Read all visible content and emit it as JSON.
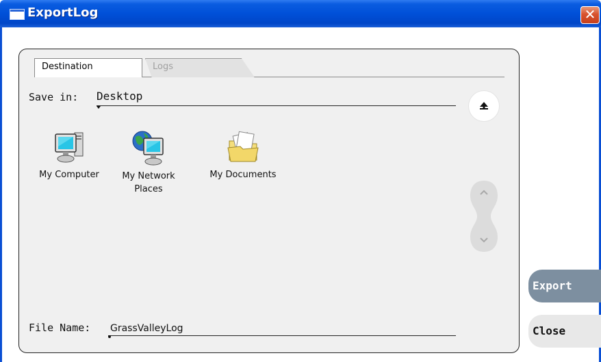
{
  "window": {
    "title": "ExportLog",
    "close_glyph": "✕"
  },
  "tabs": [
    {
      "label": "Destination",
      "active": true
    },
    {
      "label": "Logs",
      "active": false
    }
  ],
  "save_in": {
    "label": "Save in:",
    "value": "Desktop"
  },
  "items": [
    {
      "label": "My Computer",
      "icon": "computer-icon"
    },
    {
      "label": "My Network Places",
      "icon": "network-places-icon"
    },
    {
      "label": "My Documents",
      "icon": "documents-folder-icon"
    }
  ],
  "file_name": {
    "label": "File Name:",
    "value": "GrassValleyLog"
  },
  "buttons": {
    "export": "Export",
    "close": "Close"
  },
  "colors": {
    "titlebar": "#0050d8",
    "export_button": "#7d8fa0",
    "close_button": "#e8e8e8",
    "panel": "#f0f0f0"
  }
}
